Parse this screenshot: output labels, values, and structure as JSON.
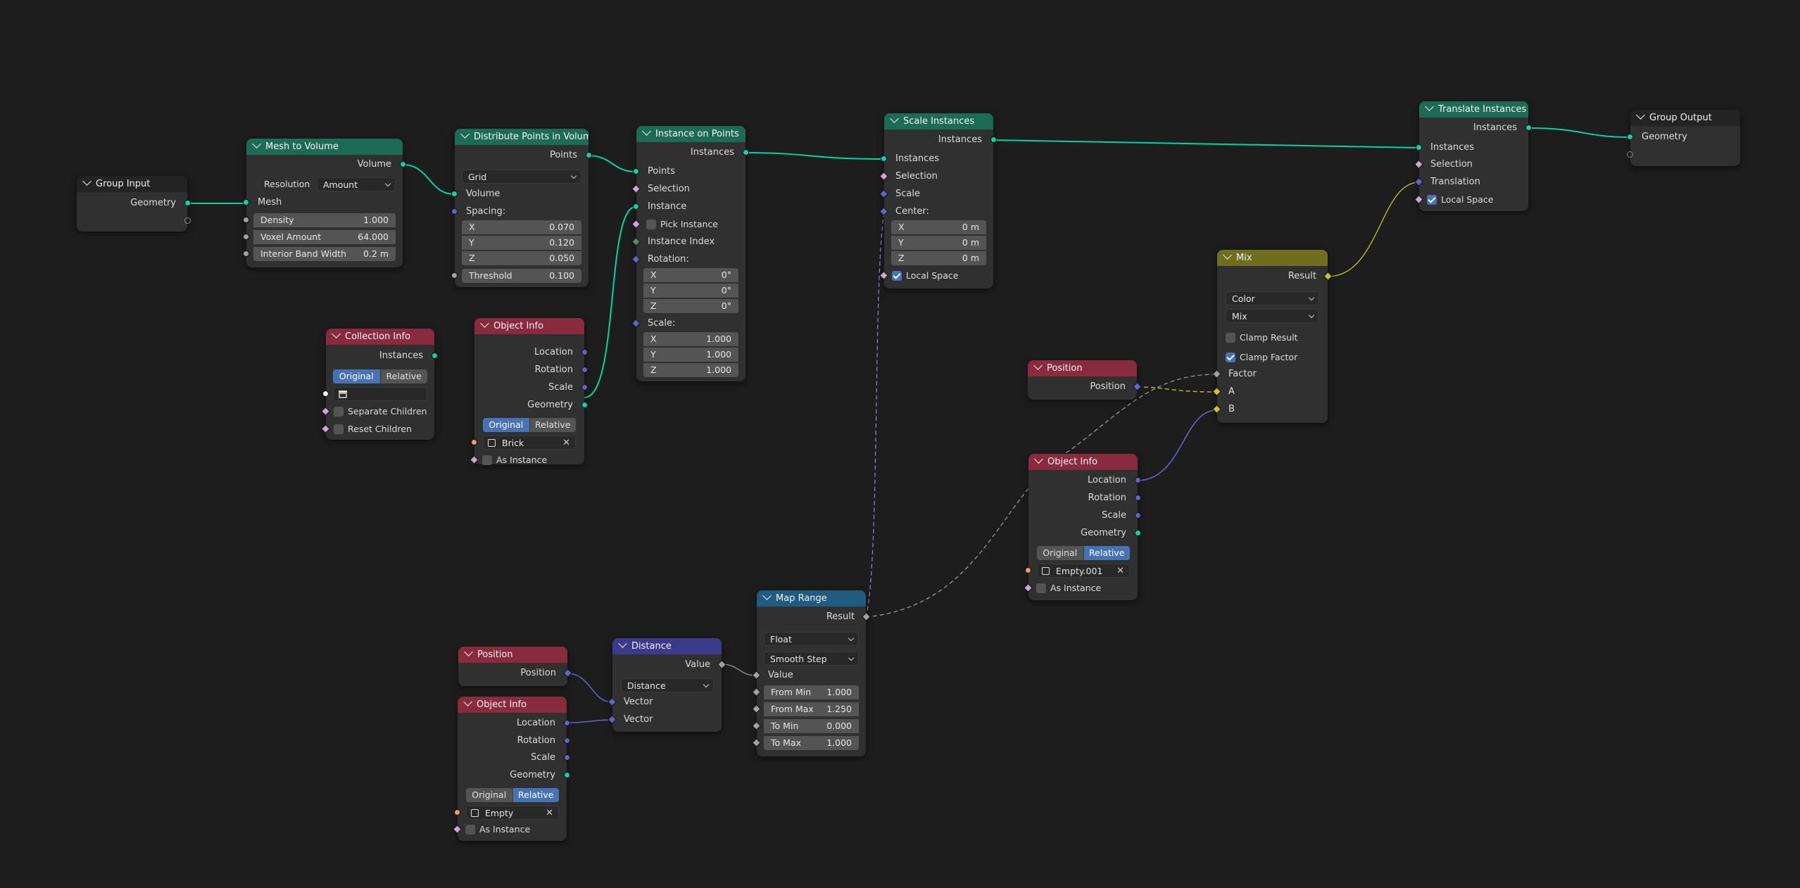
{
  "nodes": {
    "group_input": {
      "title": "Group Input",
      "geometry": "Geometry"
    },
    "mesh_to_volume": {
      "title": "Mesh to Volume",
      "volume": "Volume",
      "resolution_label": "Resolution",
      "resolution_value": "Amount",
      "mesh": "Mesh",
      "density_label": "Density",
      "density_value": "1.000",
      "voxel_amount_label": "Voxel Amount",
      "voxel_amount_value": "64.000",
      "interior_band_label": "Interior Band Width",
      "interior_band_value": "0.2 m"
    },
    "distribute_points": {
      "title": "Distribute Points in Volume",
      "points": "Points",
      "mode": "Grid",
      "volume": "Volume",
      "spacing_label": "Spacing:",
      "x_label": "X",
      "x_value": "0.070",
      "y_label": "Y",
      "y_value": "0.120",
      "z_label": "Z",
      "z_value": "0.050",
      "threshold_label": "Threshold",
      "threshold_value": "0.100"
    },
    "instance_on_points": {
      "title": "Instance on Points",
      "instances": "Instances",
      "points": "Points",
      "selection": "Selection",
      "instance": "Instance",
      "pick_instance": "Pick Instance",
      "instance_index": "Instance Index",
      "rotation_label": "Rotation:",
      "rx_label": "X",
      "rx_value": "0°",
      "ry_label": "Y",
      "ry_value": "0°",
      "rz_label": "Z",
      "rz_value": "0°",
      "scale_label": "Scale:",
      "sx_label": "X",
      "sx_value": "1.000",
      "sy_label": "Y",
      "sy_value": "1.000",
      "sz_label": "Z",
      "sz_value": "1.000"
    },
    "scale_instances": {
      "title": "Scale Instances",
      "instances_out": "Instances",
      "instances_in": "Instances",
      "selection": "Selection",
      "scale": "Scale",
      "center_label": "Center:",
      "x_label": "X",
      "x_value": "0 m",
      "y_label": "Y",
      "y_value": "0 m",
      "z_label": "Z",
      "z_value": "0 m",
      "local_space": "Local Space"
    },
    "translate_instances": {
      "title": "Translate Instances",
      "instances_out": "Instances",
      "instances_in": "Instances",
      "selection": "Selection",
      "translation": "Translation",
      "local_space": "Local Space"
    },
    "group_output": {
      "title": "Group Output",
      "geometry": "Geometry"
    },
    "collection_info": {
      "title": "Collection Info",
      "instances": "Instances",
      "original": "Original",
      "relative": "Relative",
      "separate_children": "Separate Children",
      "reset_children": "Reset Children"
    },
    "object_info_brick": {
      "title": "Object Info",
      "location": "Location",
      "rotation": "Rotation",
      "scale": "Scale",
      "geometry": "Geometry",
      "original": "Original",
      "relative": "Relative",
      "object": "Brick",
      "as_instance": "As Instance"
    },
    "mix": {
      "title": "Mix",
      "result": "Result",
      "data_type": "Color",
      "blend_type": "Mix",
      "clamp_result": "Clamp Result",
      "clamp_factor": "Clamp Factor",
      "factor": "Factor",
      "a": "A",
      "b": "B"
    },
    "position_top": {
      "title": "Position",
      "position": "Position"
    },
    "object_info_empty001": {
      "title": "Object Info",
      "location": "Location",
      "rotation": "Rotation",
      "scale": "Scale",
      "geometry": "Geometry",
      "original": "Original",
      "relative": "Relative",
      "object": "Empty.001",
      "as_instance": "As Instance"
    },
    "map_range": {
      "title": "Map Range",
      "result": "Result",
      "data_type": "Float",
      "interpolation": "Smooth Step",
      "value": "Value",
      "from_min_label": "From Min",
      "from_min_value": "1.000",
      "from_max_label": "From Max",
      "from_max_value": "1.250",
      "to_min_label": "To Min",
      "to_min_value": "0.000",
      "to_max_label": "To Max",
      "to_max_value": "1.000"
    },
    "distance": {
      "title": "Distance",
      "value": "Value",
      "operation": "Distance",
      "vector_a": "Vector",
      "vector_b": "Vector"
    },
    "position_bottom": {
      "title": "Position",
      "position": "Position"
    },
    "object_info_empty": {
      "title": "Object Info",
      "location": "Location",
      "rotation": "Rotation",
      "scale": "Scale",
      "geometry": "Geometry",
      "original": "Original",
      "relative": "Relative",
      "object": "Empty",
      "as_instance": "As Instance"
    }
  },
  "colors": {
    "background": "#1d1d1d",
    "geometry_header": "#1e6b55",
    "input_header": "#8a2a3f",
    "converter_header": "#1f5c80",
    "vector_header": "#3b3b8a",
    "color_header": "#6e6e1e",
    "group_header": "#232323",
    "geometry_socket": "#00d6a3",
    "vector_socket": "#6363c7",
    "float_socket": "#a1a1a1",
    "color_socket": "#c7c729",
    "object_socket": "#ed9e5c",
    "collection_socket": "#f5f5f5",
    "boolean_socket": "#cca6d6",
    "int_socket": "#598c5c"
  }
}
